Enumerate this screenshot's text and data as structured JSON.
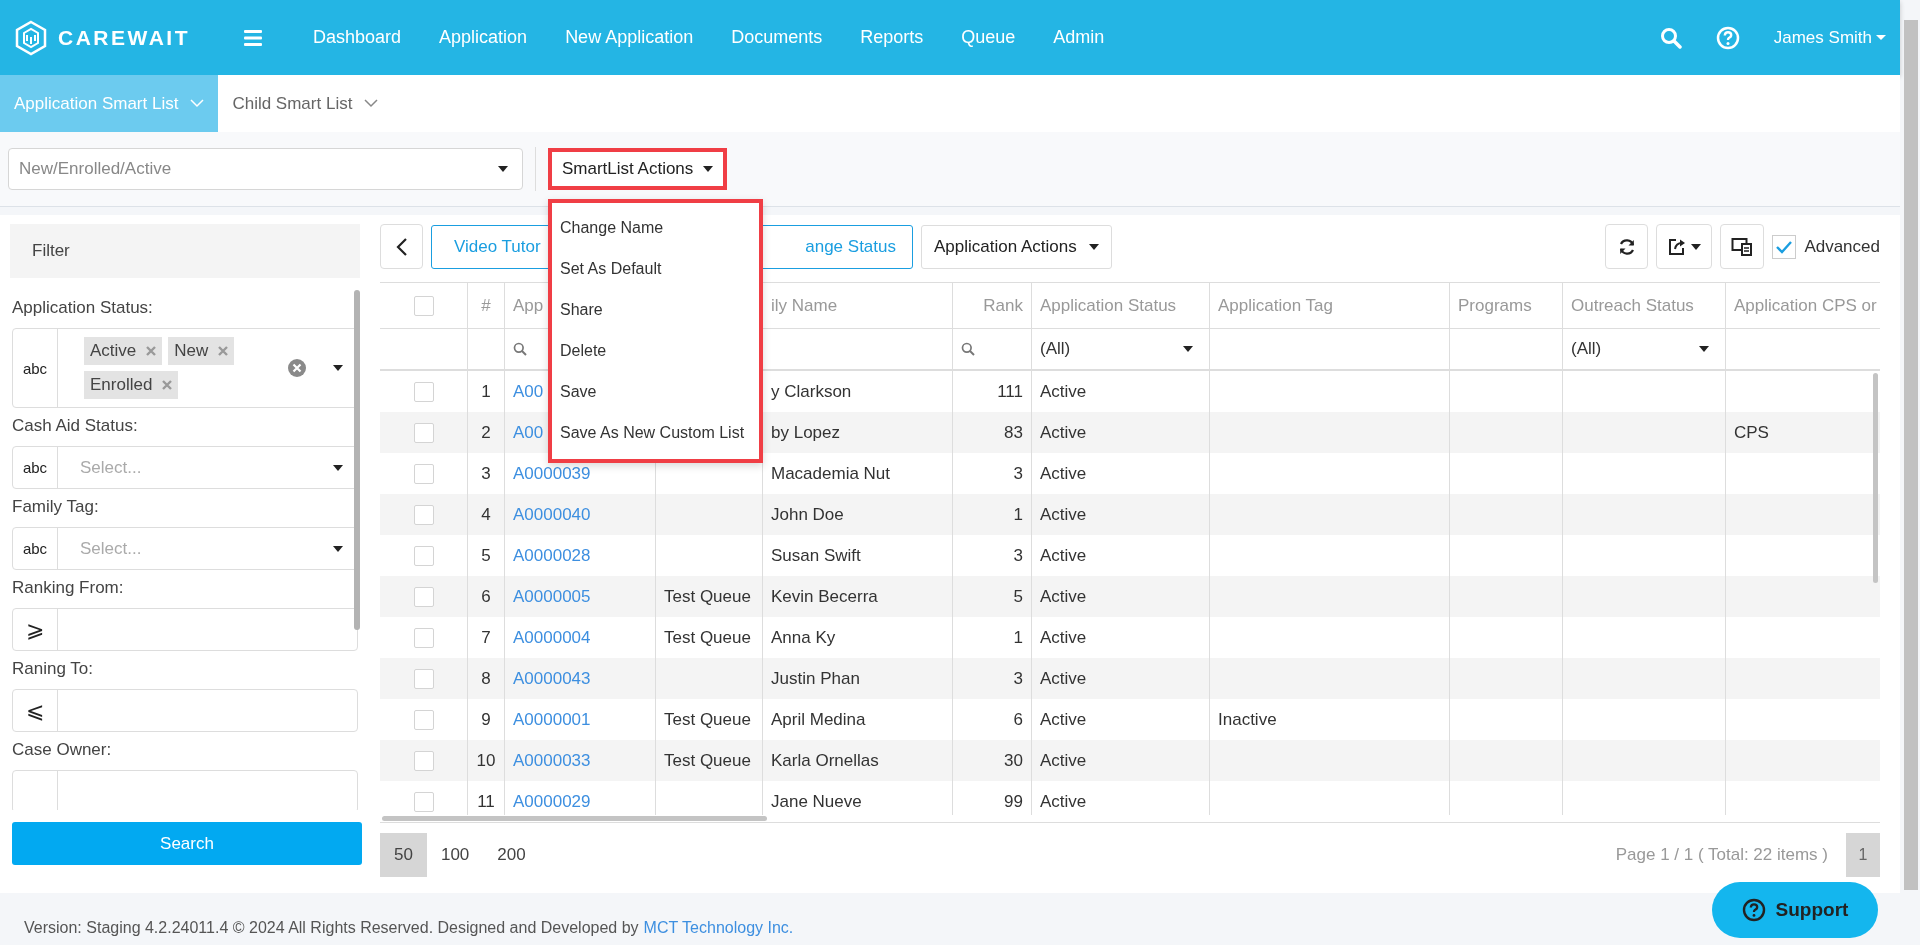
{
  "header": {
    "logo": "CAREWAIT",
    "nav": [
      "Dashboard",
      "Application",
      "New Application",
      "Documents",
      "Reports",
      "Queue",
      "Admin"
    ],
    "user": "James Smith"
  },
  "subtabs": [
    {
      "label": "Application Smart List",
      "selected": true
    },
    {
      "label": "Child Smart List",
      "selected": false
    }
  ],
  "smartlist_select": {
    "value": "New/Enrolled/Active"
  },
  "smartlist_actions": {
    "label": "SmartList Actions",
    "expanded": true,
    "items": [
      "Change Name",
      "Set As Default",
      "Share",
      "Delete",
      "Save",
      "Save As New Custom List"
    ]
  },
  "filter": {
    "title": "Filter",
    "fields": [
      {
        "kind": "multiselect",
        "label": "Application Status:",
        "addon": "abc",
        "tags": [
          "Active",
          "New",
          "Enrolled"
        ]
      },
      {
        "kind": "select",
        "label": "Cash Aid Status:",
        "addon": "abc",
        "placeholder": "Select..."
      },
      {
        "kind": "select",
        "label": "Family Tag:",
        "addon": "abc",
        "placeholder": "Select..."
      },
      {
        "kind": "input",
        "label": "Ranking From:",
        "addon": "⩾"
      },
      {
        "kind": "input",
        "label": "Raning To:",
        "addon": "⩽"
      },
      {
        "kind": "input",
        "label": "Case Owner:"
      }
    ],
    "search_button": "Search"
  },
  "toolbar": {
    "buttons": [
      "Video Tutor",
      "ange Status"
    ],
    "actions": "Application Actions",
    "advanced": {
      "label": "Advanced",
      "checked": true
    }
  },
  "table": {
    "header_checked": false,
    "columns": [
      {
        "label": "#",
        "kind": "text"
      },
      {
        "label": "App",
        "kind": "link",
        "filter": {
          "kind": "search"
        }
      },
      {
        "kind": "text"
      },
      {
        "label": "ily Name",
        "kind": "text"
      },
      {
        "label": "Rank",
        "kind": "number",
        "filter": {
          "kind": "search"
        }
      },
      {
        "label": "Application Status",
        "kind": "text",
        "filter": {
          "kind": "select",
          "value": "(All)"
        }
      },
      {
        "label": "Application Tag",
        "kind": "text"
      },
      {
        "label": "Programs",
        "kind": "text"
      },
      {
        "label": "Outreach Status",
        "kind": "text",
        "filter": {
          "kind": "select",
          "value": "(All)"
        }
      },
      {
        "label": "Application CPS or",
        "kind": "text"
      }
    ],
    "rows": [
      {
        "checked": false,
        "cells": [
          "1",
          "A00",
          null,
          "y Clarkson",
          "111",
          "Active",
          null,
          null,
          null,
          null
        ]
      },
      {
        "checked": false,
        "cells": [
          "2",
          "A00",
          null,
          "by Lopez",
          "83",
          "Active",
          null,
          null,
          null,
          "CPS"
        ]
      },
      {
        "checked": false,
        "cells": [
          "3",
          "A0000039",
          null,
          "Macademia Nut",
          "3",
          "Active",
          null,
          null,
          null,
          null
        ]
      },
      {
        "checked": false,
        "cells": [
          "4",
          "A0000040",
          null,
          "John Doe",
          "1",
          "Active",
          null,
          null,
          null,
          null
        ]
      },
      {
        "checked": false,
        "cells": [
          "5",
          "A0000028",
          null,
          "Susan Swift",
          "3",
          "Active",
          null,
          null,
          null,
          null
        ]
      },
      {
        "checked": false,
        "cells": [
          "6",
          "A0000005",
          "Test Queue",
          "Kevin Becerra",
          "5",
          "Active",
          null,
          null,
          null,
          null
        ]
      },
      {
        "checked": false,
        "cells": [
          "7",
          "A0000004",
          "Test Queue",
          "Anna Ky",
          "1",
          "Active",
          null,
          null,
          null,
          null
        ]
      },
      {
        "checked": false,
        "cells": [
          "8",
          "A0000043",
          null,
          "Justin Phan",
          "3",
          "Active",
          null,
          null,
          null,
          null
        ]
      },
      {
        "checked": false,
        "cells": [
          "9",
          "A0000001",
          "Test Queue",
          "April Medina",
          "6",
          "Active",
          "Inactive",
          null,
          null,
          null
        ]
      },
      {
        "checked": false,
        "cells": [
          "10",
          "A0000033",
          "Test Queue",
          "Karla Ornellas",
          "30",
          "Active",
          null,
          null,
          null,
          null
        ]
      },
      {
        "checked": false,
        "cells": [
          "11",
          "A0000029",
          null,
          "Jane Nueve",
          "99",
          "Active",
          null,
          null,
          null,
          null
        ]
      }
    ]
  },
  "pagination": {
    "sizes": [
      {
        "label": "50",
        "selected": true
      },
      {
        "label": "100",
        "selected": false
      },
      {
        "label": "200",
        "selected": false
      }
    ],
    "summary": "Page 1 / 1 ( Total: 22 items )",
    "page": "1"
  },
  "support": "Support",
  "footer": {
    "text": "Version: Staging 4.2.24011.4 © 2024 All Rights Reserved. Designed and Developed by",
    "link": "MCT Technology Inc."
  }
}
